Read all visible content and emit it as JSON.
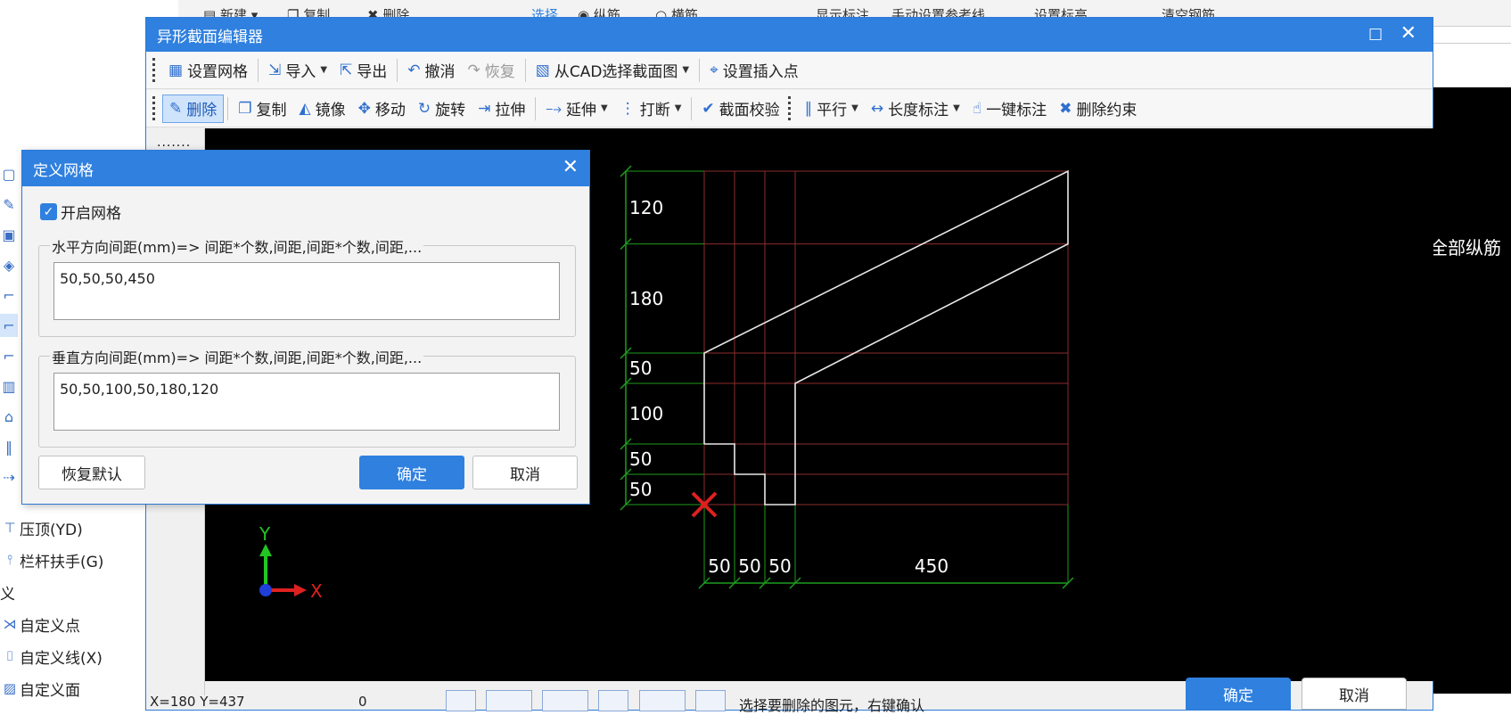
{
  "host": {
    "toolbar": [
      {
        "label": "新建",
        "icon": "new-icon"
      },
      {
        "label": "复制",
        "icon": "copy-icon"
      },
      {
        "label": "删除",
        "icon": "delete-icon"
      },
      {
        "label": "选择",
        "icon": "select-icon"
      },
      {
        "label": "纵筋",
        "icon": "radio-icon"
      },
      {
        "label": "横筋",
        "icon": "radio-icon"
      },
      {
        "label": "显示标注",
        "icon": ""
      },
      {
        "label": "手动设置参考线",
        "icon": ""
      },
      {
        "label": "设置标高",
        "icon": ""
      },
      {
        "label": "清空钢筋",
        "icon": ""
      }
    ],
    "right_text": "全部纵筋",
    "left_items": [
      {
        "label": "压顶(YD)",
        "icon": "coping-icon"
      },
      {
        "label": "栏杆扶手(G)",
        "icon": "railing-icon"
      },
      {
        "label": "义",
        "icon": ""
      },
      {
        "label": "自定义点",
        "icon": "custom-point-icon"
      },
      {
        "label": "自定义线(X)",
        "icon": "custom-line-icon"
      },
      {
        "label": "自定义面",
        "icon": "custom-face-icon"
      }
    ]
  },
  "editor": {
    "title": "异形截面编辑器",
    "maximize_glyph": "□",
    "close_glyph": "✕",
    "toolbar1": [
      {
        "label": "设置网格",
        "icon": "grid-icon",
        "glyph": "▦",
        "dropdown": false,
        "disabled": false
      },
      {
        "label": "导入",
        "icon": "import-icon",
        "glyph": "⇲",
        "dropdown": true,
        "disabled": false
      },
      {
        "label": "导出",
        "icon": "export-icon",
        "glyph": "⇱",
        "dropdown": false,
        "disabled": false
      },
      {
        "label": "撤消",
        "icon": "undo-icon",
        "glyph": "↶",
        "dropdown": false,
        "disabled": false
      },
      {
        "label": "恢复",
        "icon": "redo-icon",
        "glyph": "↷",
        "dropdown": false,
        "disabled": true
      },
      {
        "label": "从CAD选择截面图",
        "icon": "cad-select-icon",
        "glyph": "▧",
        "dropdown": true,
        "disabled": false
      },
      {
        "label": "设置插入点",
        "icon": "insert-point-icon",
        "glyph": "⌖",
        "dropdown": false,
        "disabled": false
      }
    ],
    "toolbar2": [
      {
        "label": "删除",
        "icon": "eraser-icon",
        "glyph": "✎",
        "dropdown": false,
        "active": true
      },
      {
        "label": "复制",
        "icon": "copy-icon",
        "glyph": "❐",
        "dropdown": false,
        "active": false
      },
      {
        "label": "镜像",
        "icon": "mirror-icon",
        "glyph": "◭",
        "dropdown": false,
        "active": false
      },
      {
        "label": "移动",
        "icon": "move-icon",
        "glyph": "✥",
        "dropdown": false,
        "active": false
      },
      {
        "label": "旋转",
        "icon": "rotate-icon",
        "glyph": "↻",
        "dropdown": false,
        "active": false
      },
      {
        "label": "拉伸",
        "icon": "stretch-icon",
        "glyph": "⇥",
        "dropdown": false,
        "active": false
      },
      {
        "label": "延伸",
        "icon": "extend-icon",
        "glyph": "⤍",
        "dropdown": true,
        "active": false
      },
      {
        "label": "打断",
        "icon": "break-icon",
        "glyph": "⋮",
        "dropdown": true,
        "active": false
      },
      {
        "label": "截面校验",
        "icon": "check-icon",
        "glyph": "✔",
        "dropdown": false,
        "active": false
      },
      {
        "label": "平行",
        "icon": "parallel-icon",
        "glyph": "∥",
        "dropdown": true,
        "active": false
      },
      {
        "label": "长度标注",
        "icon": "dimension-icon",
        "glyph": "↔",
        "dropdown": true,
        "active": false
      },
      {
        "label": "一键标注",
        "icon": "auto-dimension-icon",
        "glyph": "☝",
        "dropdown": false,
        "active": false
      },
      {
        "label": "删除约束",
        "icon": "delete-constraint-icon",
        "glyph": "✖",
        "dropdown": false,
        "active": false
      }
    ],
    "leftstrip_dots": "·······",
    "status": {
      "coords": "X=180 Y=437",
      "zero": "0",
      "message": "选择要删除的图元，右键确认",
      "ok": "确定",
      "cancel": "取消"
    },
    "canvas": {
      "horizontal_dims": [
        "50",
        "50",
        "50",
        "450"
      ],
      "vertical_dims": [
        "120",
        "180",
        "50",
        "100",
        "50",
        "50"
      ],
      "axis_x": "X",
      "axis_y": "Y",
      "grid_color": "#8b2c2c",
      "dim_color": "#1e9c1e",
      "shape_color": "#e8e8e8",
      "origin_marker_color": "#e02020"
    }
  },
  "grid_dialog": {
    "title": "定义网格",
    "close_glyph": "✕",
    "enable_label": "开启网格",
    "enable_checked": true,
    "horizontal_legend": "水平方向间距(mm)=> 间距*个数,间距,间距*个数,间距,...",
    "horizontal_value": "50,50,50,450",
    "vertical_legend": "垂直方向间距(mm)=> 间距*个数,间距,间距*个数,间距,...",
    "vertical_value": "50,50,100,50,180,120",
    "restore_label": "恢复默认",
    "ok_label": "确定",
    "cancel_label": "取消"
  }
}
